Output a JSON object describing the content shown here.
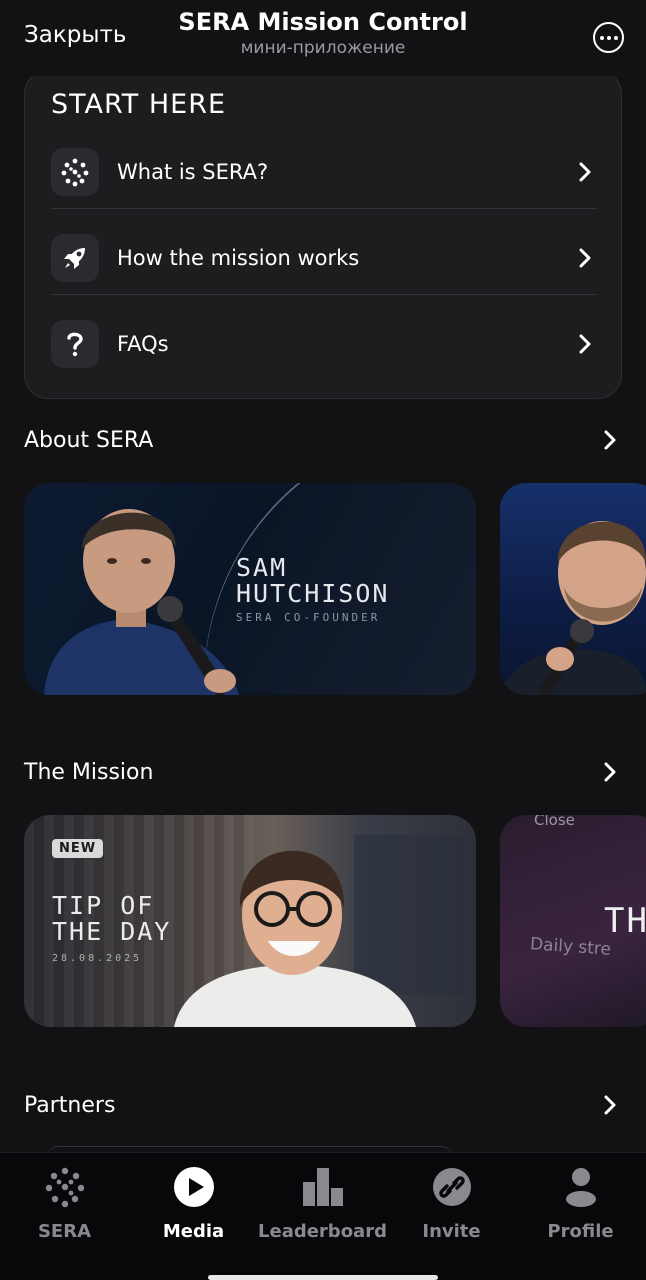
{
  "header": {
    "close_label": "Закрыть",
    "title": "SERA Mission Control",
    "subtitle": "мини-приложение"
  },
  "start_here": {
    "title": "START HERE",
    "items": [
      {
        "label": "What is SERA?",
        "icon": "sera-logo-icon"
      },
      {
        "label": "How the mission works",
        "icon": "rocket-icon"
      },
      {
        "label": "FAQs",
        "icon": "question-icon"
      }
    ]
  },
  "sections": {
    "about": {
      "title": "About SERA",
      "card1": {
        "name_line1": "SAM",
        "name_line2": "HUTCHISON",
        "role": "SERA CO-FOUNDER"
      }
    },
    "mission": {
      "title": "The Mission",
      "card1": {
        "badge": "NEW",
        "title_line1": "TIP OF",
        "title_line2": "THE DAY",
        "date": "28.08.2025"
      },
      "card2": {
        "title": "TH",
        "streak": "Daily stre",
        "close_text": "Close"
      }
    },
    "partners": {
      "title": "Partners"
    }
  },
  "bottom_nav": {
    "items": [
      {
        "label": "SERA",
        "icon": "sera-logo-icon",
        "active": false
      },
      {
        "label": "Media",
        "icon": "play-icon",
        "active": true
      },
      {
        "label": "Leaderboard",
        "icon": "bar-chart-icon",
        "active": false
      },
      {
        "label": "Invite",
        "icon": "link-icon",
        "active": false
      },
      {
        "label": "Profile",
        "icon": "person-icon",
        "active": false
      }
    ]
  },
  "colors": {
    "background": "#121214",
    "card": "#1d1d20",
    "nav_inactive": "#8a8a8e",
    "nav_active": "#ffffff"
  }
}
